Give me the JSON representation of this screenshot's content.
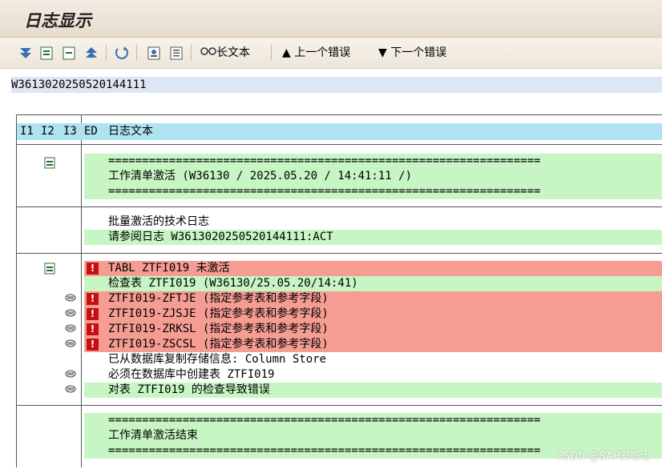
{
  "window": {
    "title": "日志显示"
  },
  "toolbar": {
    "long_text_label": "长文本",
    "prev_error_label": "上一个错误",
    "next_error_label": "下一个错误"
  },
  "log_id": "W3613020250520144111",
  "table": {
    "headers": {
      "i1": "I1",
      "i2": "I2",
      "i3": "I3",
      "ed": "ED",
      "text": "日志文本"
    },
    "sections": [
      {
        "rows": [
          {
            "type": "green",
            "text": "================================================================"
          },
          {
            "type": "green",
            "text": "工作清单激活 (W36130 / 2025.05.20 / 14:41:11 /)"
          },
          {
            "type": "green",
            "text": "================================================================"
          }
        ]
      },
      {
        "rows": [
          {
            "type": "plain",
            "text": "批量激活的技术日志"
          },
          {
            "type": "green",
            "text": "请参阅日志 W3613020250520144111:ACT"
          }
        ]
      },
      {
        "rows": [
          {
            "type": "red",
            "text": "TABL ZTFI019 未激活"
          },
          {
            "type": "green",
            "text": "检查表 ZTFI019 (W36130/25.05.20/14:41)"
          },
          {
            "type": "red",
            "text": "ZTFI019-ZFTJE (指定参考表和参考字段)"
          },
          {
            "type": "red",
            "text": "ZTFI019-ZJSJE (指定参考表和参考字段)"
          },
          {
            "type": "red",
            "text": "ZTFI019-ZRKSL (指定参考表和参考字段)"
          },
          {
            "type": "red",
            "text": "ZTFI019-ZSCSL (指定参考表和参考字段)"
          },
          {
            "type": "plain",
            "text": "已从数据库复制存储信息: Column Store"
          },
          {
            "type": "plain",
            "text": "必须在数据库中创建表 ZTFI019"
          },
          {
            "type": "green",
            "text": "对表 ZTFI019 的检查导致错误"
          }
        ]
      },
      {
        "rows": [
          {
            "type": "green",
            "text": "================================================================"
          },
          {
            "type": "green",
            "text": "工作清单激活结束"
          },
          {
            "type": "green",
            "text": "================================================================"
          }
        ]
      }
    ]
  },
  "watermark": "CSDN @SAP安哥士",
  "colors": {
    "header_bg": "#aee3f0",
    "green_row": "#c7f5c4",
    "red_row": "#f59c93",
    "error_icon": "#c41010"
  }
}
